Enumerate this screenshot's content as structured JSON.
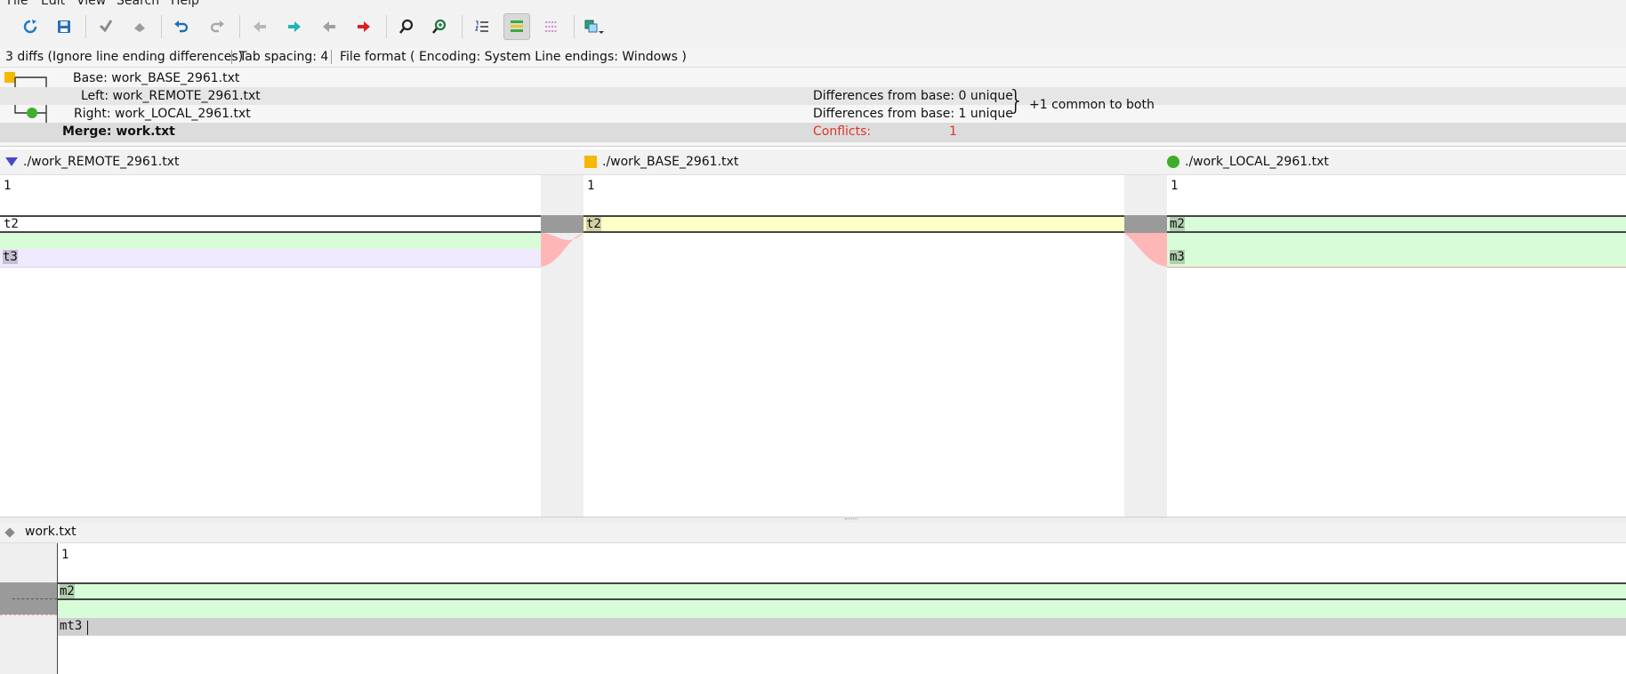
{
  "menu": [
    "File",
    "Edit",
    "View",
    "Search",
    "Help"
  ],
  "toolbar_icons": [
    "refresh-icon",
    "save-icon",
    "mark-icon",
    "unmark-icon",
    "undo-icon",
    "redo-icon",
    "first-diff-icon",
    "next-diff-icon",
    "prev-diff-icon",
    "last-diff-icon",
    "find-icon",
    "find-next-icon",
    "line-numbers-icon",
    "show-diffs-icon",
    "whitespace-icon",
    "view-mode-icon"
  ],
  "status": {
    "diffs": "3 diffs (Ignore line ending differences)",
    "tab": "Tab spacing: 4",
    "format": "File format ( Encoding: System  Line endings: Windows )"
  },
  "info": {
    "base": "Base: work_BASE_2961.txt",
    "left": "Left: work_REMOTE_2961.txt",
    "right": "Right: work_LOCAL_2961.txt",
    "merge": "Merge: work.txt",
    "left_diffs": "Differences from base: 0 unique",
    "right_diffs": "Differences from base: 1 unique",
    "common": "+1 common to both",
    "conflicts_label": "Conflicts:",
    "conflicts_value": "1"
  },
  "panes": {
    "left": {
      "path": "./work_REMOTE_2961.txt",
      "lines": [
        "1",
        "t2",
        "",
        "t3"
      ]
    },
    "base": {
      "path": "./work_BASE_2961.txt",
      "lines": [
        "1",
        "t2"
      ]
    },
    "right": {
      "path": "./work_LOCAL_2961.txt",
      "lines": [
        "1",
        "m2",
        "",
        "m3"
      ]
    }
  },
  "merge": {
    "title": "work.txt",
    "lines": [
      "1",
      "m2",
      "",
      "mt3"
    ]
  },
  "colors": {
    "conflict_yellow": "#ffffc8",
    "diff_green": "#d8fcd8",
    "diff_purple": "#f0eaff",
    "deleted_red": "#ffb6b6",
    "remote_marker": "#4b47c8",
    "base_marker": "#f5b800",
    "local_marker": "#3fae2a"
  }
}
